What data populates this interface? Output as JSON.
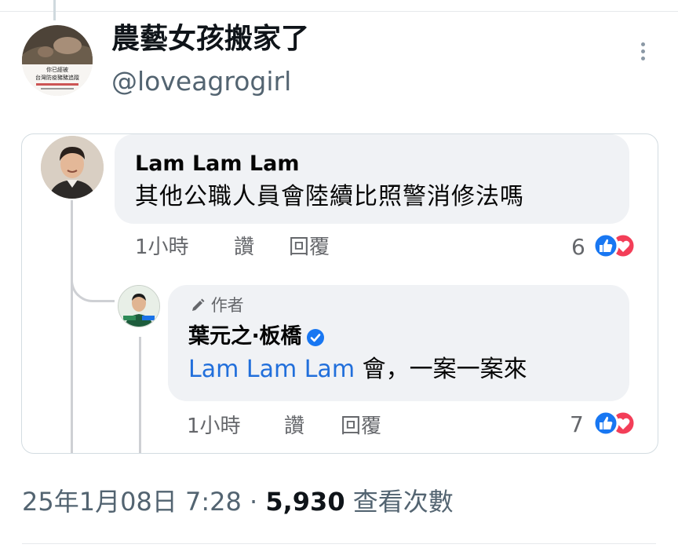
{
  "tweet": {
    "display_name": "農藝女孩搬家了",
    "handle": "@loveagrogirl",
    "avatar_caption_line1": "你已經被",
    "avatar_caption_line2": "台灣防疫豬豬追蹤",
    "date": "25年1月08日 7:28",
    "separator": "·",
    "views_count": "5,930",
    "views_label": "查看次數"
  },
  "comment1": {
    "author": "Lam Lam Lam",
    "text": "其他公職人員會陸續比照警消修法嗎",
    "time": "1小時",
    "like_label": "讚",
    "reply_label": "回覆",
    "reaction_count": "6"
  },
  "comment2": {
    "badge": "作者",
    "author": "葉元之‧板橋",
    "mention": "Lam Lam Lam",
    "text": " 會，一案一案來",
    "time": "1小時",
    "like_label": "讚",
    "reply_label": "回覆",
    "reaction_count": "7"
  },
  "colors": {
    "like_blue": "#1877f2",
    "love_red": "#f33e58",
    "mention_blue": "#216fdb",
    "secondary_text": "#536471"
  },
  "icons": [
    "more-vertical-icon",
    "pen-icon",
    "verified-badge-icon",
    "like-reaction-icon",
    "love-reaction-icon"
  ]
}
